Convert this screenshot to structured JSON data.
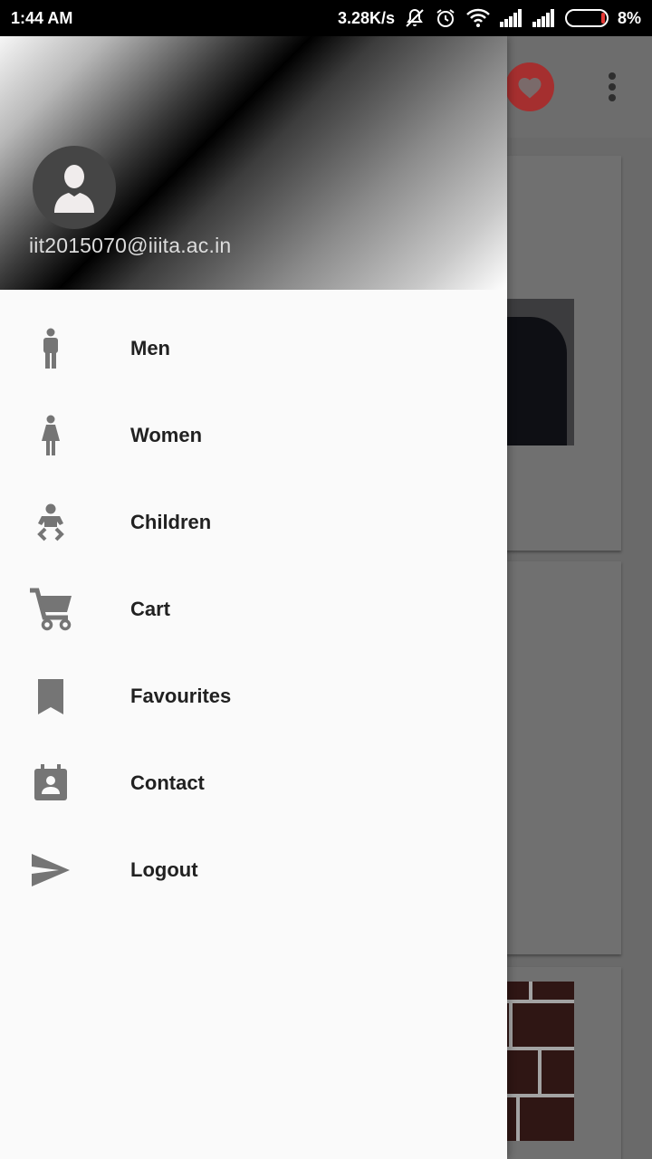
{
  "status_bar": {
    "time": "1:44 AM",
    "net_speed": "3.28K/s",
    "battery": "8%",
    "battery_level": 0.08,
    "icons": [
      "mute-icon",
      "alarm-icon",
      "wifi-icon",
      "signal-icon",
      "signal-icon",
      "battery-icon"
    ]
  },
  "drawer": {
    "email": "iit2015070@iiita.ac.in",
    "items": [
      {
        "label": "Men",
        "icon": "man-icon"
      },
      {
        "label": "Women",
        "icon": "woman-icon"
      },
      {
        "label": "Children",
        "icon": "child-icon"
      },
      {
        "label": "Cart",
        "icon": "cart-icon"
      },
      {
        "label": "Favourites",
        "icon": "bookmark-icon"
      },
      {
        "label": "Contact",
        "icon": "contact-icon"
      },
      {
        "label": "Logout",
        "icon": "send-icon"
      }
    ]
  },
  "background_app": {
    "accent_color": "#a52f2f",
    "icons": [
      "heart-icon",
      "more-vert-icon"
    ]
  },
  "colors": {
    "drawer_bg": "#fafafa",
    "icon_gray": "#757575",
    "label_text": "#212121",
    "scrim": "#6a6a6a"
  }
}
